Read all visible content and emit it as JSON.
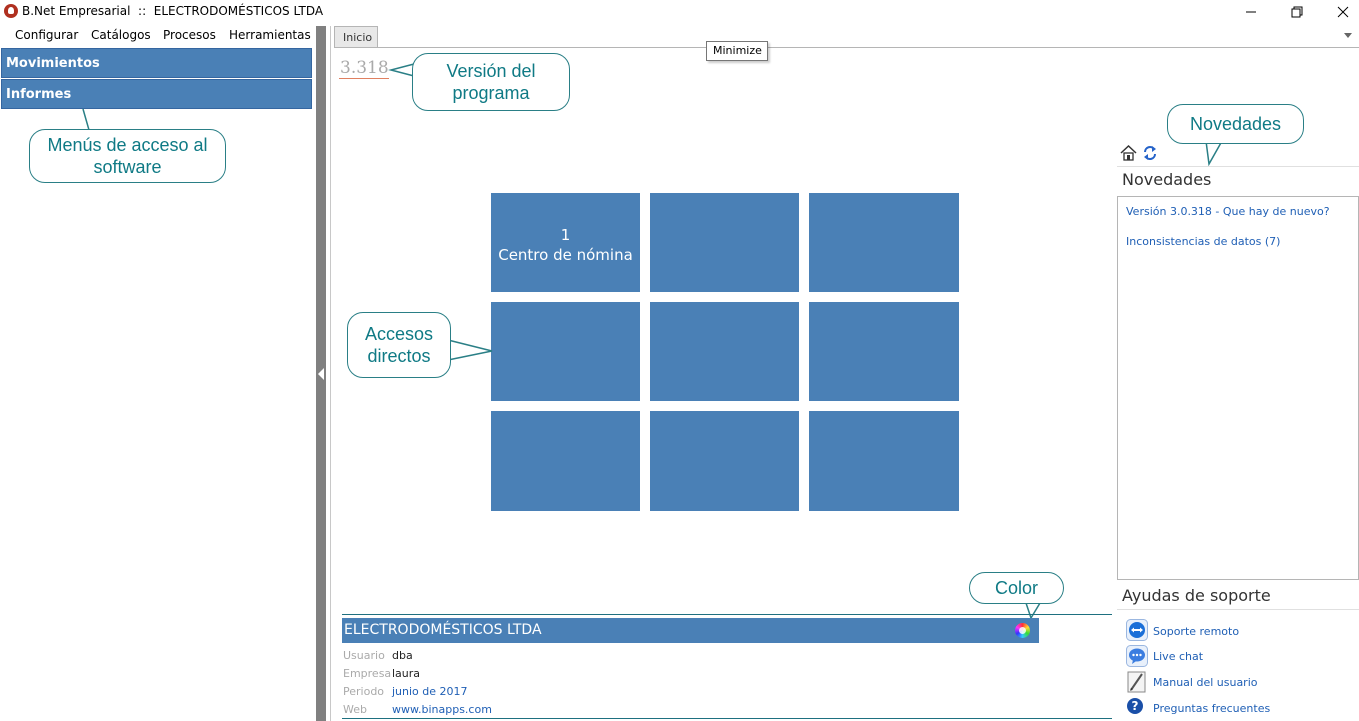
{
  "window": {
    "title": "B.Net Empresarial  ::  ELECTRODOMÉSTICOS LTDA"
  },
  "menu": [
    "Configurar",
    "Catálogos",
    "Procesos",
    "Herramientas"
  ],
  "nav": {
    "items": [
      "Movimientos",
      "Informes"
    ]
  },
  "tabs": {
    "active": "Inicio"
  },
  "tooltip": "Minimize",
  "version": "3.318",
  "callouts": {
    "version": "Versión del programa",
    "menus": "Menús de acceso al software",
    "accesos": "Accesos directos",
    "novedades": "Novedades",
    "color": "Color"
  },
  "tiles": [
    {
      "number": "1",
      "label": "Centro de nómina"
    },
    {
      "number": "",
      "label": ""
    },
    {
      "number": "",
      "label": ""
    },
    {
      "number": "",
      "label": ""
    },
    {
      "number": "",
      "label": ""
    },
    {
      "number": "",
      "label": ""
    },
    {
      "number": "",
      "label": ""
    },
    {
      "number": "",
      "label": ""
    },
    {
      "number": "",
      "label": ""
    }
  ],
  "news": {
    "title": "Novedades",
    "items": [
      "Versión 3.0.318 - Que hay de nuevo?",
      "Inconsistencias de datos (7)"
    ],
    "icons": [
      "home-icon",
      "refresh-icon"
    ]
  },
  "support": {
    "title": "Ayudas de soporte",
    "items": [
      {
        "label": "Soporte remoto",
        "icon": "teamviewer-icon"
      },
      {
        "label": "Live chat",
        "icon": "chat-icon"
      },
      {
        "label": "Manual del usuario",
        "icon": "manual-icon"
      },
      {
        "label": "Preguntas frecuentes",
        "icon": "help-icon"
      }
    ]
  },
  "company": {
    "name": "ELECTRODOMÉSTICOS LTDA",
    "fields": [
      {
        "label": "Usuario",
        "value": "dba"
      },
      {
        "label": "Empresa",
        "value": "laura"
      },
      {
        "label": "Periodo",
        "value": "junio de 2017"
      },
      {
        "label": "Web",
        "value": "www.binapps.com"
      }
    ]
  },
  "colors": {
    "accent": "#4a80b6",
    "callout": "#0f7a85",
    "link": "#1f5fb5"
  }
}
